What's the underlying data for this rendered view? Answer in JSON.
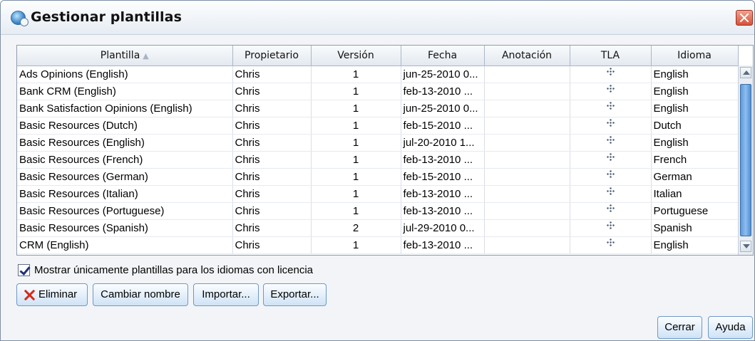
{
  "window": {
    "title": "Gestionar plantillas"
  },
  "table": {
    "columns": [
      "Plantilla",
      "Propietario",
      "Versión",
      "Fecha",
      "Anotación",
      "TLA",
      "Idioma"
    ],
    "rows": [
      {
        "plantilla": "Ads Opinions (English)",
        "propietario": "Chris",
        "version": "1",
        "fecha": "jun-25-2010 0...",
        "anotacion": "",
        "idioma": "English"
      },
      {
        "plantilla": "Bank CRM (English)",
        "propietario": "Chris",
        "version": "1",
        "fecha": "feb-13-2010 ...",
        "anotacion": "",
        "idioma": "English"
      },
      {
        "plantilla": "Bank Satisfaction Opinions (English)",
        "propietario": "Chris",
        "version": "1",
        "fecha": "jun-25-2010 0...",
        "anotacion": "",
        "idioma": "English"
      },
      {
        "plantilla": "Basic Resources (Dutch)",
        "propietario": "Chris",
        "version": "1",
        "fecha": "feb-15-2010 ...",
        "anotacion": "",
        "idioma": "Dutch"
      },
      {
        "plantilla": "Basic Resources (English)",
        "propietario": "Chris",
        "version": "1",
        "fecha": "jul-20-2010 1...",
        "anotacion": "",
        "idioma": "English"
      },
      {
        "plantilla": "Basic Resources (French)",
        "propietario": "Chris",
        "version": "1",
        "fecha": "feb-13-2010 ...",
        "anotacion": "",
        "idioma": "French"
      },
      {
        "plantilla": "Basic Resources (German)",
        "propietario": "Chris",
        "version": "1",
        "fecha": "feb-15-2010 ...",
        "anotacion": "",
        "idioma": "German"
      },
      {
        "plantilla": "Basic Resources (Italian)",
        "propietario": "Chris",
        "version": "1",
        "fecha": "feb-13-2010 ...",
        "anotacion": "",
        "idioma": "Italian"
      },
      {
        "plantilla": "Basic Resources (Portuguese)",
        "propietario": "Chris",
        "version": "1",
        "fecha": "feb-13-2010 ...",
        "anotacion": "",
        "idioma": "Portuguese"
      },
      {
        "plantilla": "Basic Resources (Spanish)",
        "propietario": "Chris",
        "version": "2",
        "fecha": "jul-29-2010 0...",
        "anotacion": "",
        "idioma": "Spanish"
      },
      {
        "plantilla": "CRM (English)",
        "propietario": "Chris",
        "version": "1",
        "fecha": "feb-13-2010 ...",
        "anotacion": "",
        "idioma": "English"
      }
    ]
  },
  "options": {
    "licensed_only_label": "Mostrar únicamente plantillas para los idiomas con licencia",
    "licensed_only_checked": true
  },
  "buttons": {
    "delete": "Eliminar",
    "rename": "Cambiar nombre",
    "import": "Importar...",
    "export": "Exportar...",
    "close": "Cerrar",
    "help": "Ayuda"
  },
  "icons": {
    "app": "app-icon",
    "close": "close-icon",
    "delete": "delete-x-icon",
    "tla": "tla-tree-icon",
    "sort": "sort-ascending-icon"
  },
  "colors": {
    "accent": "#5d9bdc",
    "delete_icon": "#d62a1a"
  }
}
